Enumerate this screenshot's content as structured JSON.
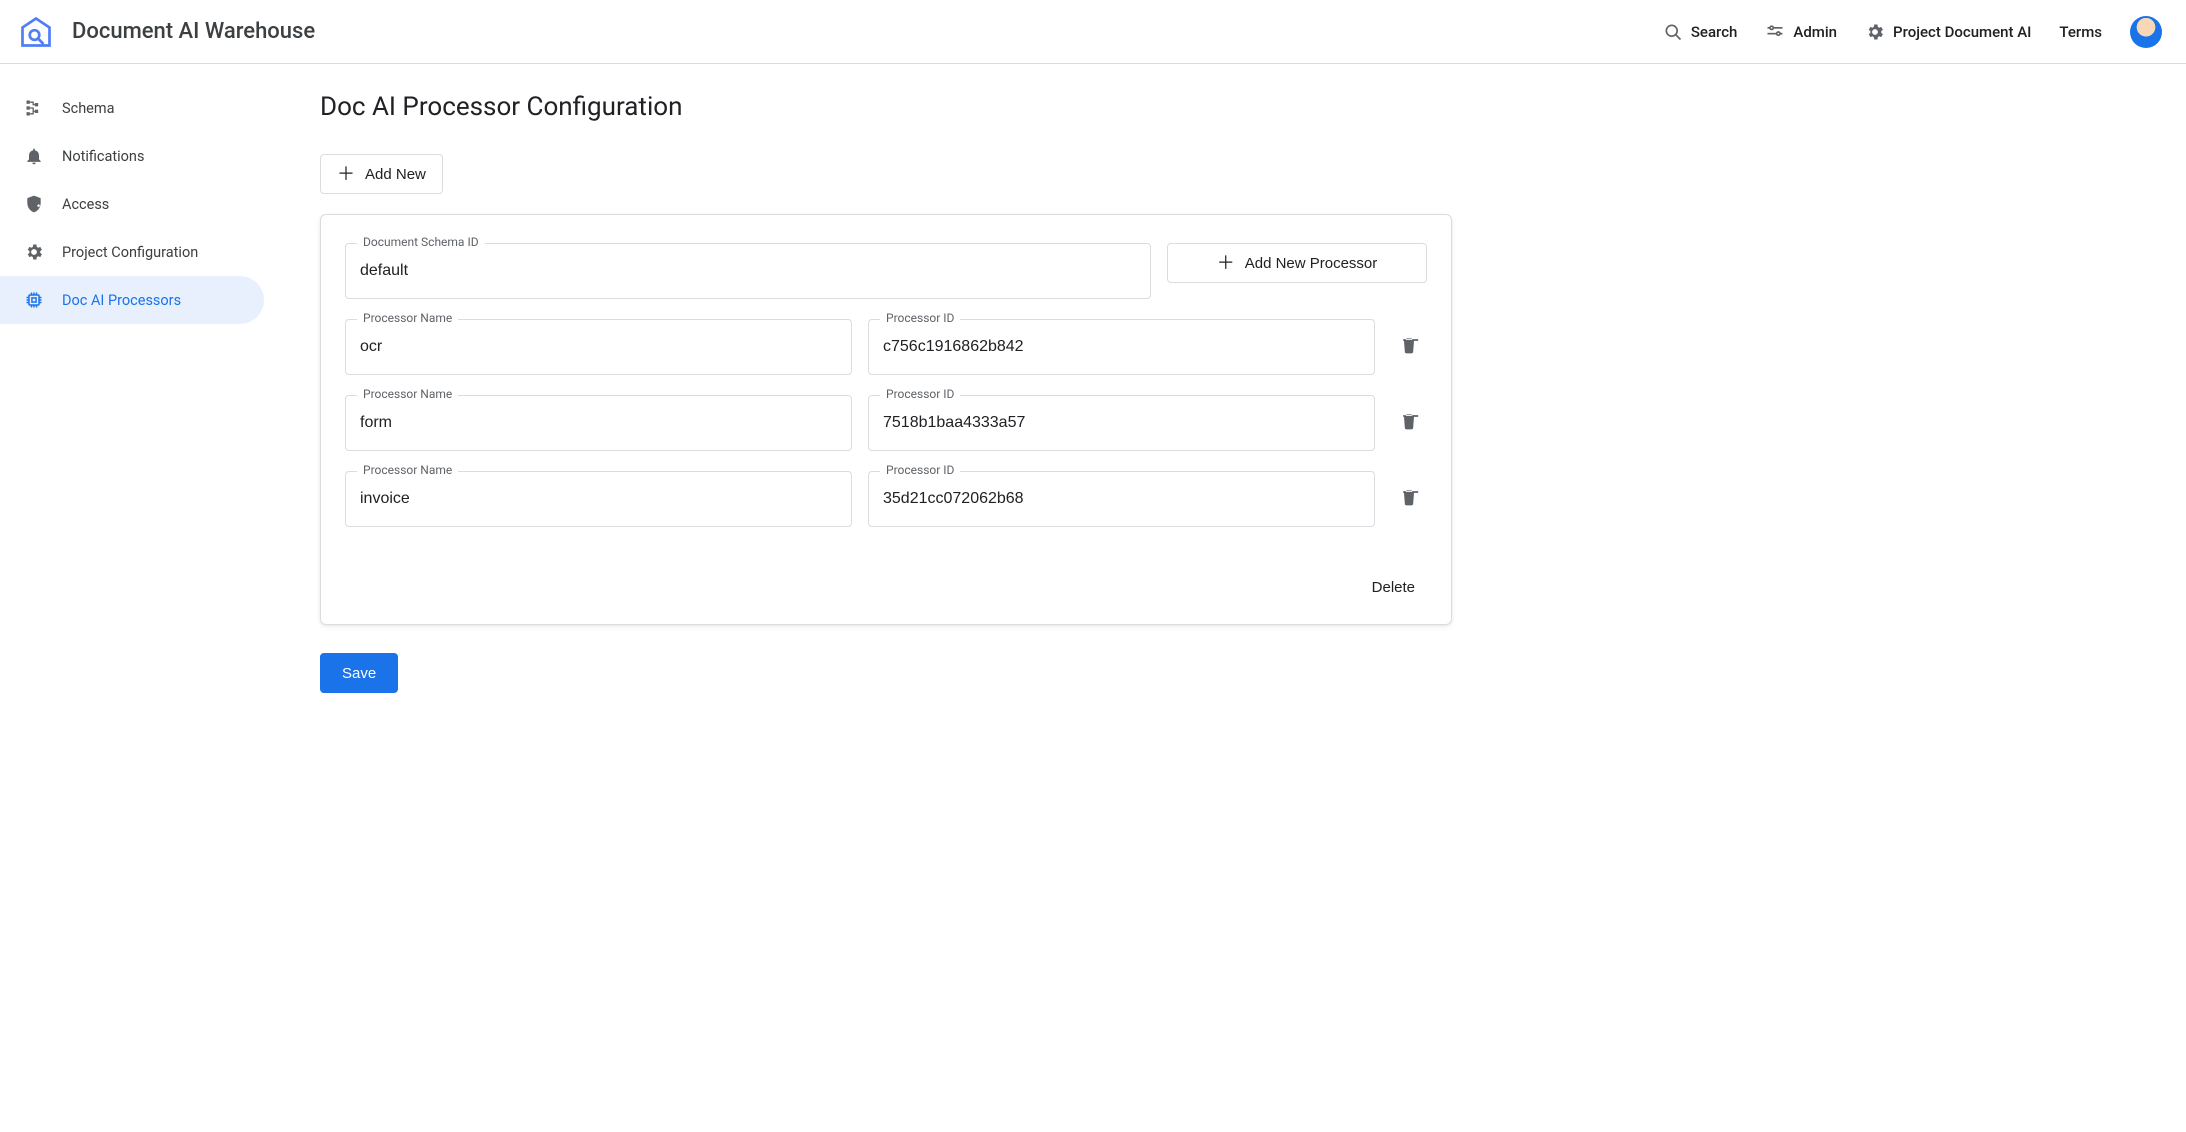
{
  "header": {
    "app_title": "Document AI Warehouse",
    "search_label": "Search",
    "admin_label": "Admin",
    "project_label": "Project Document AI",
    "terms_label": "Terms"
  },
  "sidebar": {
    "items": [
      {
        "label": "Schema"
      },
      {
        "label": "Notifications"
      },
      {
        "label": "Access"
      },
      {
        "label": "Project Configuration"
      },
      {
        "label": "Doc AI Processors"
      }
    ],
    "active_index": 4
  },
  "main": {
    "page_title": "Doc AI Processor Configuration",
    "add_new_label": "Add New",
    "schema_id_label": "Document Schema ID",
    "schema_id_value": "default",
    "add_processor_label": "Add New Processor",
    "processor_name_label": "Processor Name",
    "processor_id_label": "Processor ID",
    "processors": [
      {
        "name": "ocr",
        "id": "c756c1916862b842"
      },
      {
        "name": "form",
        "id": "7518b1baa4333a57"
      },
      {
        "name": "invoice",
        "id": "35d21cc072062b68"
      }
    ],
    "delete_label": "Delete",
    "save_label": "Save"
  }
}
